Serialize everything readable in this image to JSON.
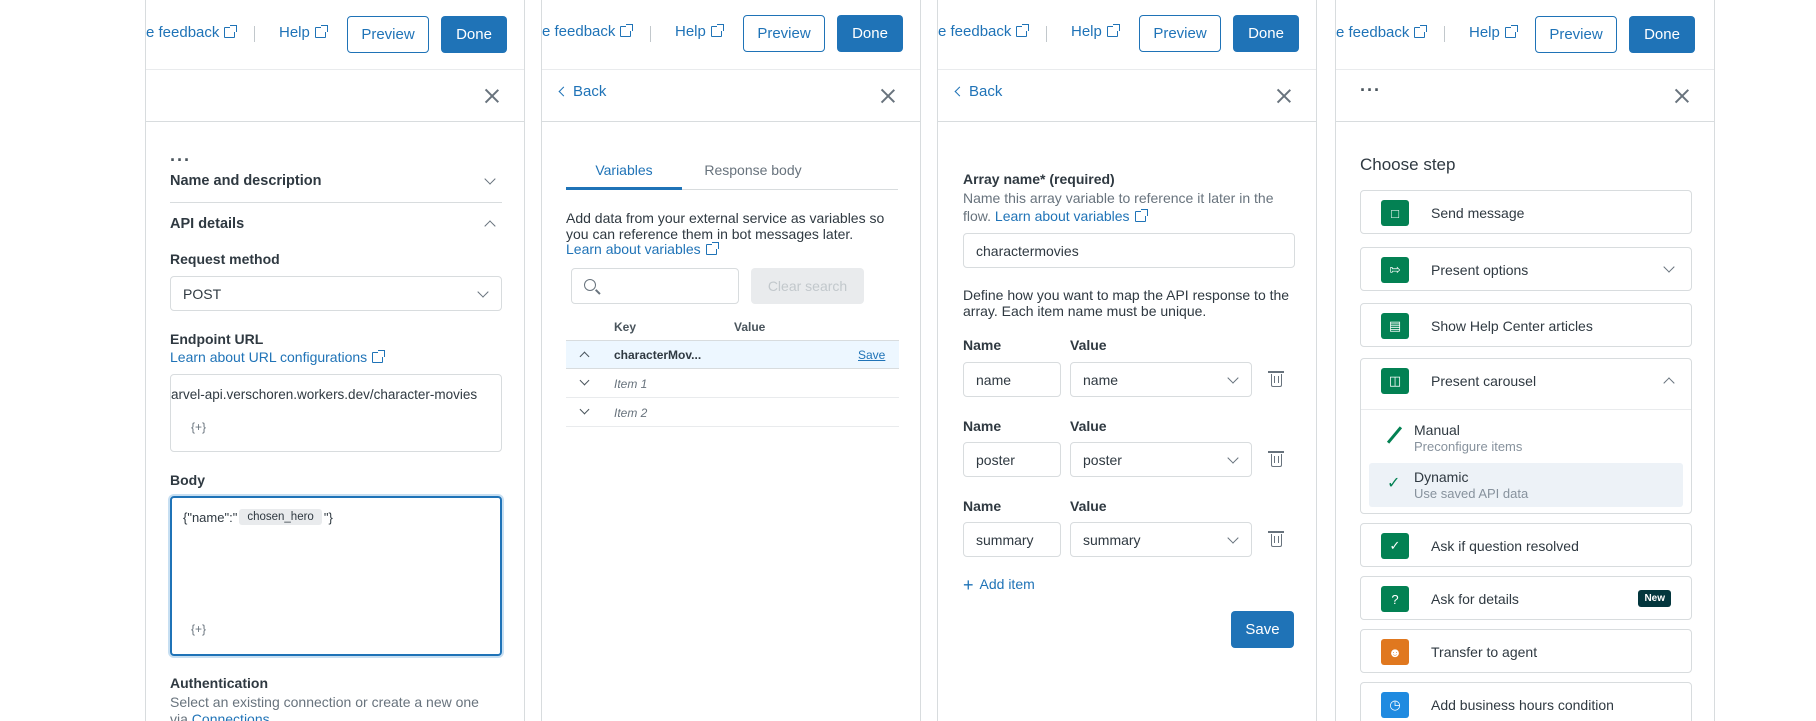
{
  "header": {
    "feedback": "e feedback",
    "help": "Help",
    "preview": "Preview",
    "done": "Done"
  },
  "panel1": {
    "name_desc": "Name and description",
    "api_details": "API details",
    "request_method_label": "Request method",
    "request_method_value": "POST",
    "endpoint_label": "Endpoint URL",
    "endpoint_link": "Learn about URL configurations",
    "endpoint_value": "arvel-api.verschoren.workers.dev/character-movies",
    "insert_var": "{+}",
    "body_label": "Body",
    "body_prefix": "{\"name\":\"",
    "body_token": "chosen_hero",
    "body_suffix": "\"}",
    "auth_label": "Authentication",
    "auth_desc": "Select an existing connection or create a new one",
    "auth_via": "via",
    "auth_link": "Connections"
  },
  "panel2": {
    "back": "Back",
    "tab_variables": "Variables",
    "tab_response": "Response body",
    "desc": "Add data from your external service as variables so you can reference them in bot messages later.",
    "learn_link": "Learn about variables",
    "search_placeholder": "",
    "clear_search": "Clear search",
    "col_key": "Key",
    "col_value": "Value",
    "rows": [
      {
        "key": "characterMov...",
        "action": "Save"
      },
      {
        "key": "Item 1"
      },
      {
        "key": "Item 2"
      }
    ]
  },
  "panel3": {
    "back": "Back",
    "array_label": "Array name* (required)",
    "array_desc": "Name this array variable to reference it later in the flow.",
    "learn_link": "Learn about variables",
    "array_value": "charactermovies",
    "map_desc": "Define how you want to map the API response to the array. Each item name must be unique.",
    "name_label": "Name",
    "value_label": "Value",
    "items": [
      {
        "name": "name",
        "value": "name"
      },
      {
        "name": "poster",
        "value": "poster"
      },
      {
        "name": "summary",
        "value": "summary"
      }
    ],
    "add_item": "Add item",
    "save": "Save"
  },
  "panel4": {
    "title": "Choose step",
    "steps": [
      {
        "label": "Send message",
        "color": "#038153"
      },
      {
        "label": "Present options",
        "color": "#038153"
      },
      {
        "label": "Show Help Center articles",
        "color": "#038153"
      },
      {
        "label": "Present carousel",
        "color": "#038153"
      },
      {
        "label": "Ask if question resolved",
        "color": "#038153"
      },
      {
        "label": "Ask for details",
        "color": "#038153",
        "badge": "New"
      },
      {
        "label": "Transfer to agent",
        "color": "#e0781f"
      },
      {
        "label": "Add business hours condition",
        "color": "#1f8ae0"
      }
    ],
    "carousel_options": [
      {
        "title": "Manual",
        "sub": "Preconfigure items"
      },
      {
        "title": "Dynamic",
        "sub": "Use saved API data"
      }
    ]
  }
}
